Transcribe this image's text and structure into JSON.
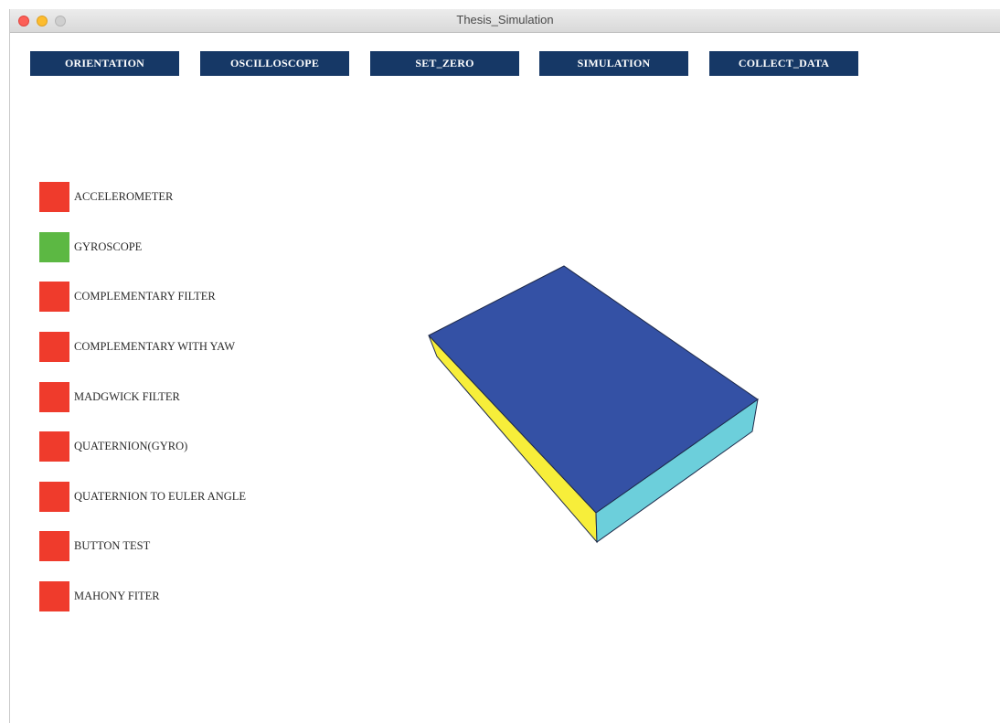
{
  "window": {
    "title": "Thesis_Simulation"
  },
  "toolbar": {
    "buttons": [
      {
        "label": "ORIENTATION"
      },
      {
        "label": "OSCILLOSCOPE"
      },
      {
        "label": "SET_ZERO"
      },
      {
        "label": "SIMULATION"
      },
      {
        "label": "COLLECT_DATA"
      }
    ]
  },
  "indicators": [
    {
      "label": "ACCELEROMETER",
      "color": "#ef3b2c"
    },
    {
      "label": "GYROSCOPE",
      "color": "#5cb843"
    },
    {
      "label": "COMPLEMENTARY FILTER",
      "color": "#ef3b2c"
    },
    {
      "label": "COMPLEMENTARY WITH YAW",
      "color": "#ef3b2c"
    },
    {
      "label": "MADGWICK FILTER",
      "color": "#ef3b2c"
    },
    {
      "label": "QUATERNION(GYRO)",
      "color": "#ef3b2c"
    },
    {
      "label": "QUATERNION TO EULER ANGLE",
      "color": "#ef3b2c"
    },
    {
      "label": "BUTTON TEST",
      "color": "#ef3b2c"
    },
    {
      "label": "MAHONY FITER",
      "color": "#ef3b2c"
    }
  ],
  "model": {
    "top_color": "#3451a5",
    "left_side_color": "#f7ee3a",
    "right_side_color": "#6ccfdb",
    "edge_color": "#1e2a4a"
  }
}
